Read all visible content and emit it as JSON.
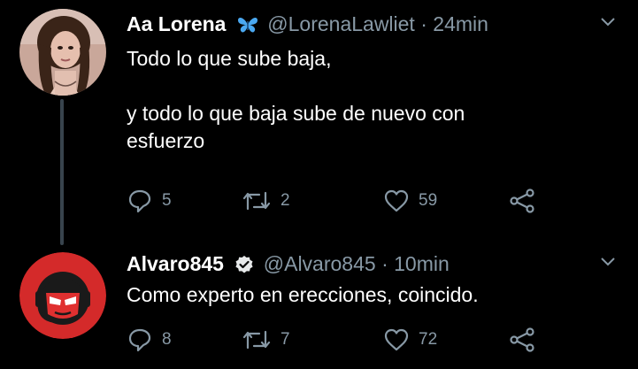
{
  "tweets": [
    {
      "display_name": "Aa Lorena",
      "name_emoji": "butterfly-icon",
      "handle": "@LorenaLawliet",
      "separator": "·",
      "time": "24min",
      "text_lines": [
        "Todo lo que sube baja,",
        "y todo lo que baja sube de nuevo con",
        "esfuerzo"
      ],
      "replies": "5",
      "retweets": "2",
      "likes": "59"
    },
    {
      "display_name": "Alvaro845",
      "verified": true,
      "handle": "@Alvaro845",
      "separator": "·",
      "time": "10min",
      "text_lines": [
        "Como experto en erecciones, coincido."
      ],
      "replies": "8",
      "retweets": "7",
      "likes": "72"
    }
  ],
  "colors": {
    "background": "#000000",
    "text": "#ffffff",
    "secondary": "#8899a6",
    "thread_line": "#38444d",
    "butterfly": "#4aa8f0",
    "avatar_red": "#d42a2a"
  }
}
